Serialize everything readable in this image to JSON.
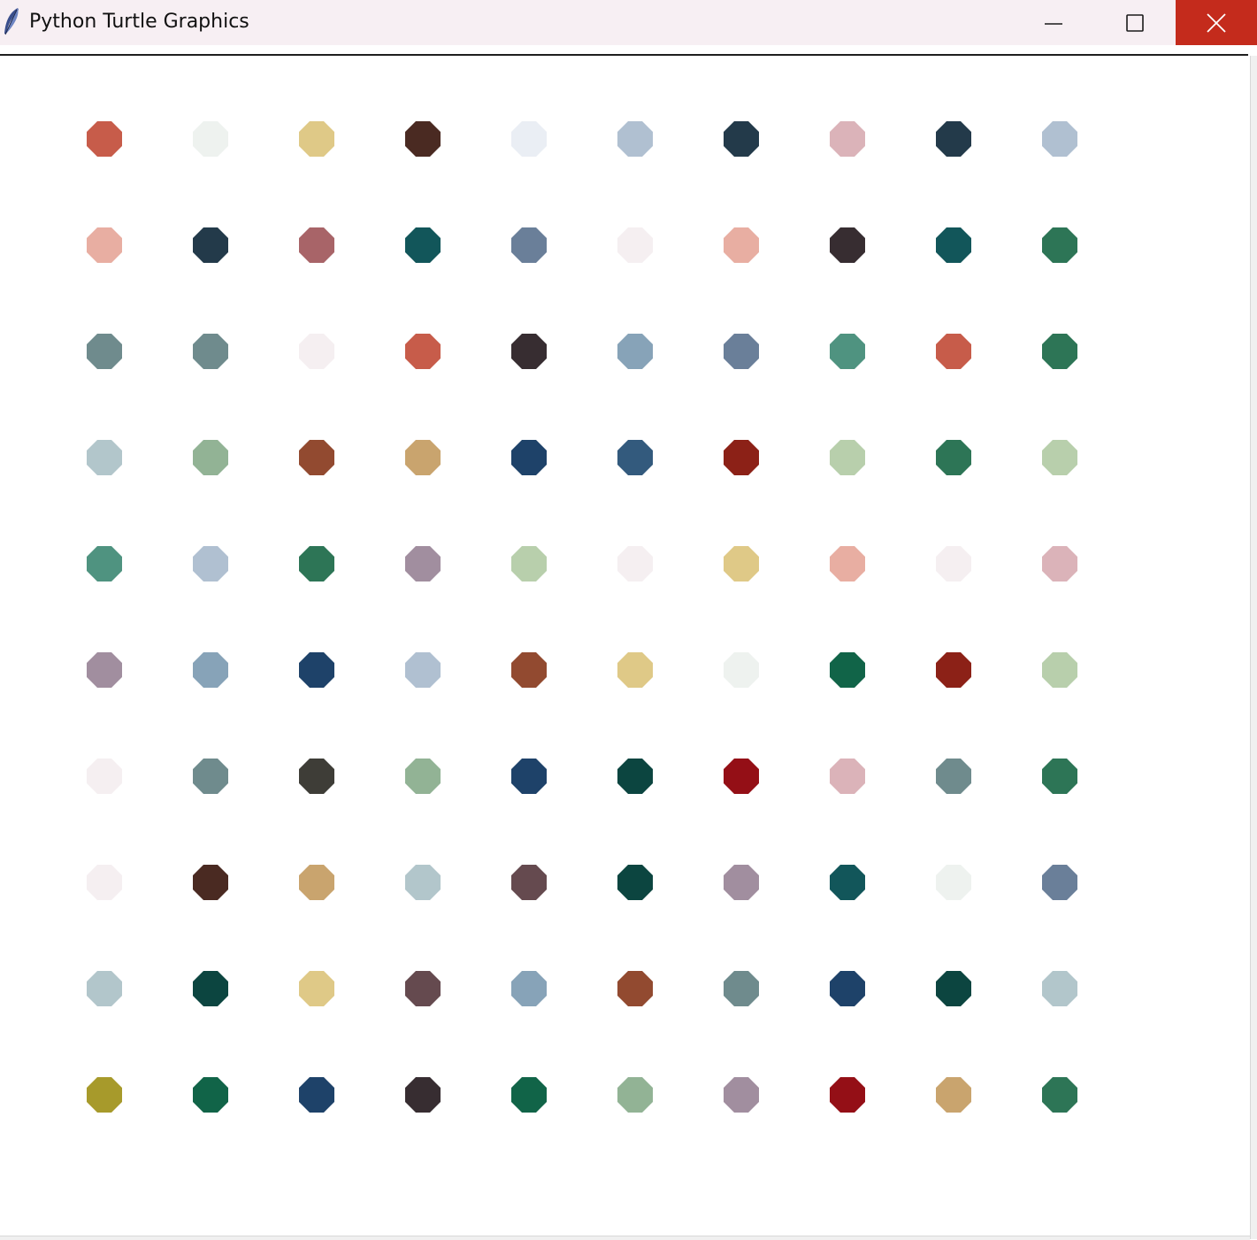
{
  "window": {
    "title": "Python Turtle Graphics",
    "icon": "feather-icon",
    "buttons": {
      "minimize": "minimize-icon",
      "maximize": "maximize-icon",
      "close": "close-icon"
    },
    "close_color": "#c42b1c"
  },
  "canvas": {
    "background": "#ffffff",
    "rows": [
      [
        "#c75c4a",
        "#eef2ef",
        "#dfc987",
        "#4a2a22",
        "#eaeef4",
        "#b0c0d1",
        "#233a4a",
        "#dbb3b9",
        "#233a4a",
        "#b0c0d1"
      ],
      [
        "#e8aea2",
        "#233a4a",
        "#a86468",
        "#12565a",
        "#6a7f99",
        "#f5eff1",
        "#e8aea2",
        "#372d31",
        "#12565a",
        "#2d7556"
      ],
      [
        "#6f8b8d",
        "#6f8b8d",
        "#f5eff1",
        "#c75c4a",
        "#372d31",
        "#87a3b8",
        "#6a7f99",
        "#4f9380",
        "#c75c4a",
        "#2d7556"
      ],
      [
        "#b2c6cb",
        "#92b395",
        "#924a30",
        "#c9a46e",
        "#1e4269",
        "#335a7d",
        "#8c2117",
        "#b8cfac",
        "#2d7556",
        "#b8cfac"
      ],
      [
        "#4f9380",
        "#b0c0d1",
        "#2d7556",
        "#a18e9f",
        "#b8cfac",
        "#f5eff1",
        "#dfc987",
        "#e8aea2",
        "#f5eff1",
        "#dbb3b9"
      ],
      [
        "#a18e9f",
        "#87a3b8",
        "#1e4269",
        "#b0c0d1",
        "#924a30",
        "#dfc987",
        "#eef2ef",
        "#116448",
        "#8c2117",
        "#b8cfac"
      ],
      [
        "#f5eff1",
        "#6f8b8d",
        "#3e3d37",
        "#92b395",
        "#1e4269",
        "#0c4540",
        "#940f16",
        "#dbb3b9",
        "#6f8b8d",
        "#2d7556"
      ],
      [
        "#f5eff1",
        "#4a2a22",
        "#c9a46e",
        "#b2c6cb",
        "#654a4f",
        "#0c4540",
        "#a18e9f",
        "#12565a",
        "#eef2ef",
        "#6a7f99"
      ],
      [
        "#b2c6cb",
        "#0c4540",
        "#dfc987",
        "#654a4f",
        "#87a3b8",
        "#924a30",
        "#6f8b8d",
        "#1e4269",
        "#0c4540",
        "#b2c6cb"
      ],
      [
        "#a79a2b",
        "#116448",
        "#1e4269",
        "#372d31",
        "#116448",
        "#92b395",
        "#a18e9f",
        "#940f16",
        "#c9a46e",
        "#2d7556"
      ]
    ]
  }
}
